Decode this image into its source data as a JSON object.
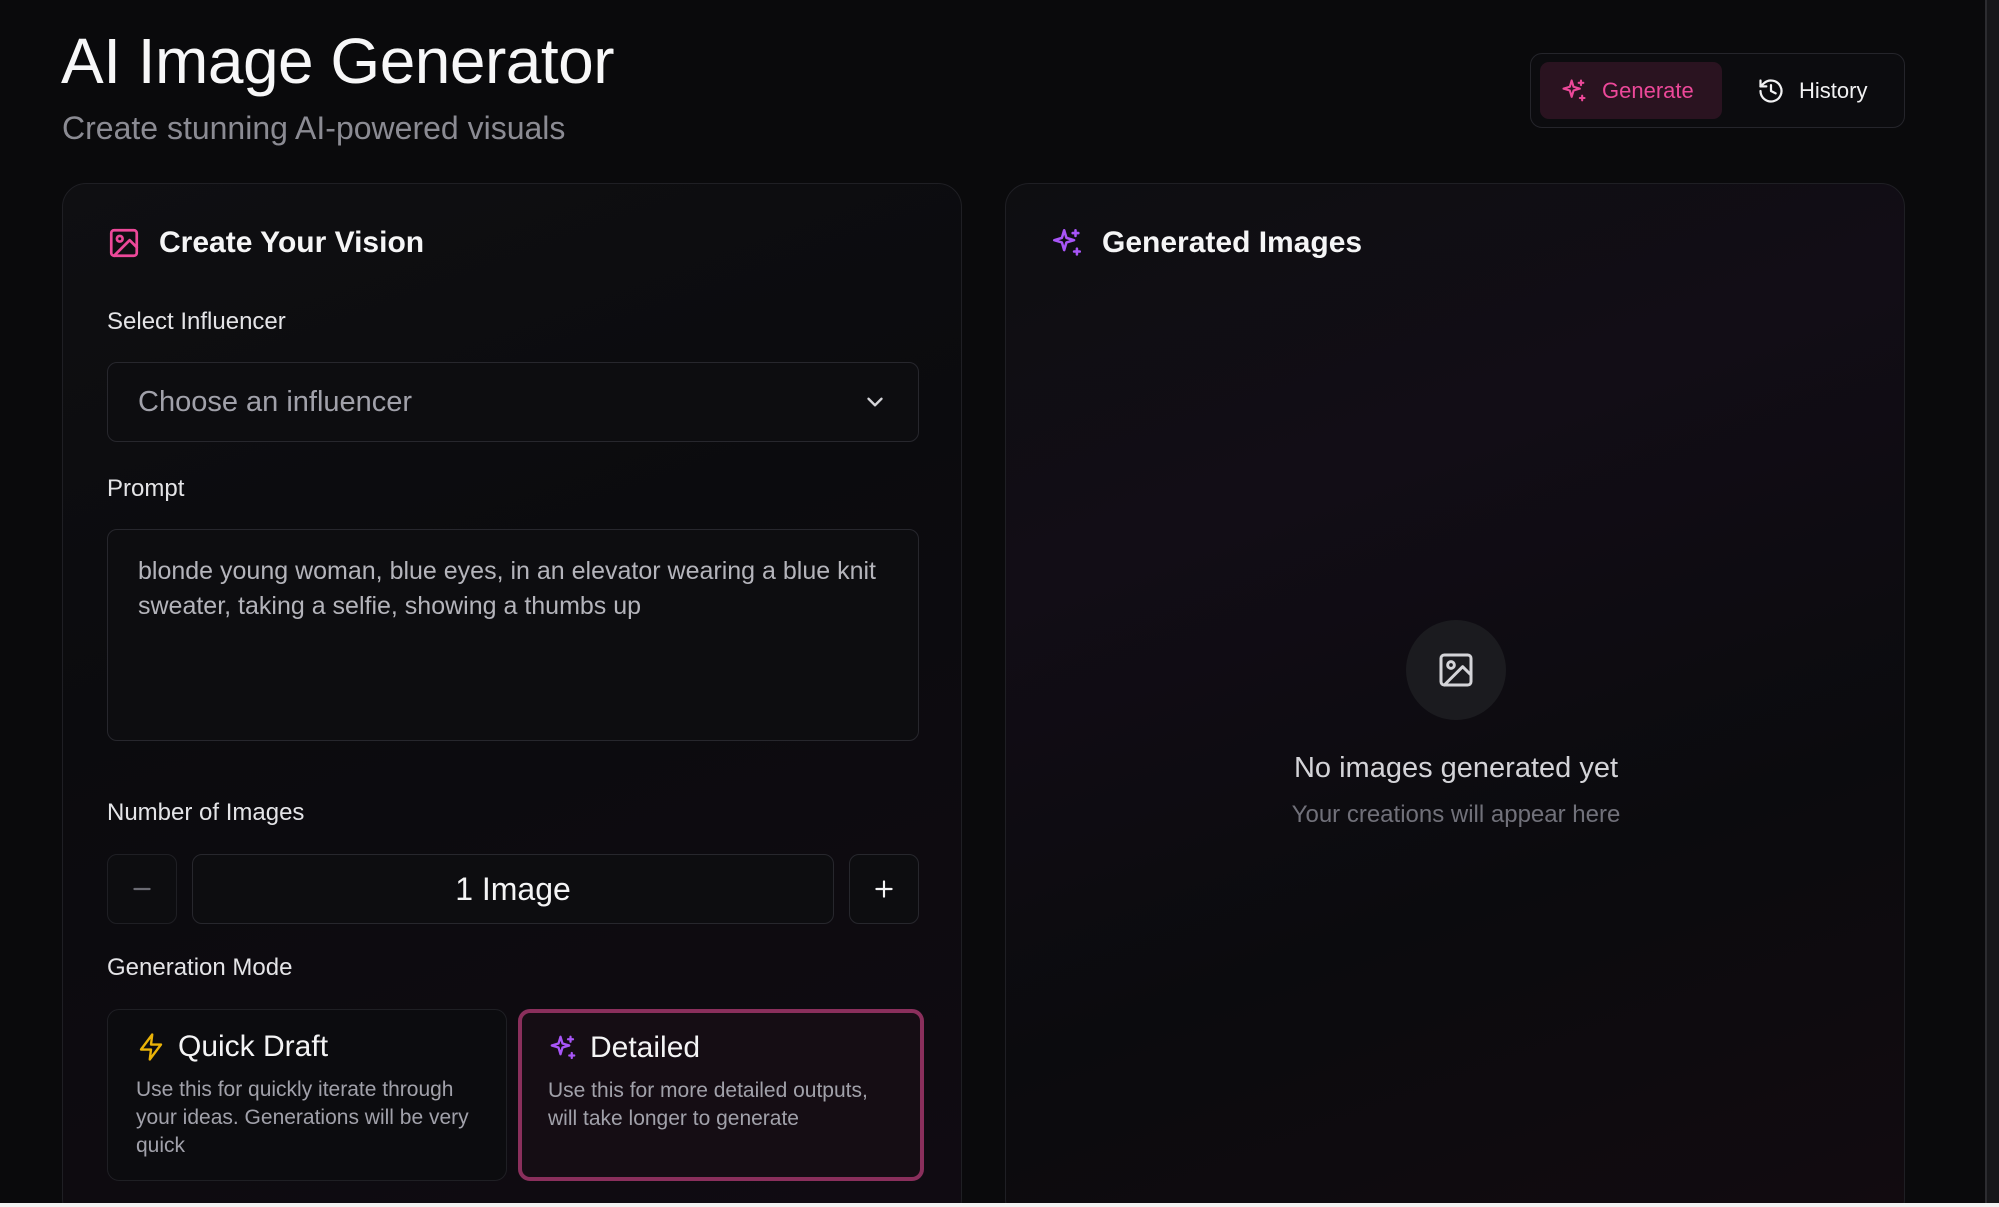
{
  "header": {
    "title": "AI Image Generator",
    "subtitle": "Create stunning AI-powered visuals"
  },
  "view_toggle": {
    "generate_label": "Generate",
    "history_label": "History",
    "active": "Generate"
  },
  "create_panel": {
    "title": "Create Your Vision",
    "influencer": {
      "label": "Select Influencer",
      "placeholder": "Choose an influencer"
    },
    "prompt": {
      "label": "Prompt",
      "value": "blonde young woman, blue eyes, in an elevator wearing a blue knit sweater, taking a selfie, showing a thumbs up"
    },
    "image_count": {
      "label": "Number of Images",
      "value": "1 Image"
    },
    "mode": {
      "label": "Generation Mode",
      "selected": "Detailed",
      "options": [
        {
          "title": "Quick Draft",
          "description": "Use this for quickly iterate through your ideas. Generations will be very quick"
        },
        {
          "title": "Detailed",
          "description": "Use this for more detailed outputs, will take longer to generate"
        }
      ]
    }
  },
  "results_panel": {
    "title": "Generated Images",
    "empty_title": "No images generated yet",
    "empty_subtitle": "Your creations will appear here"
  },
  "colors": {
    "accent_pink": "#ec4899",
    "accent_purple": "#a855f7",
    "quick_icon": "#eab308",
    "background": "#09090b"
  }
}
